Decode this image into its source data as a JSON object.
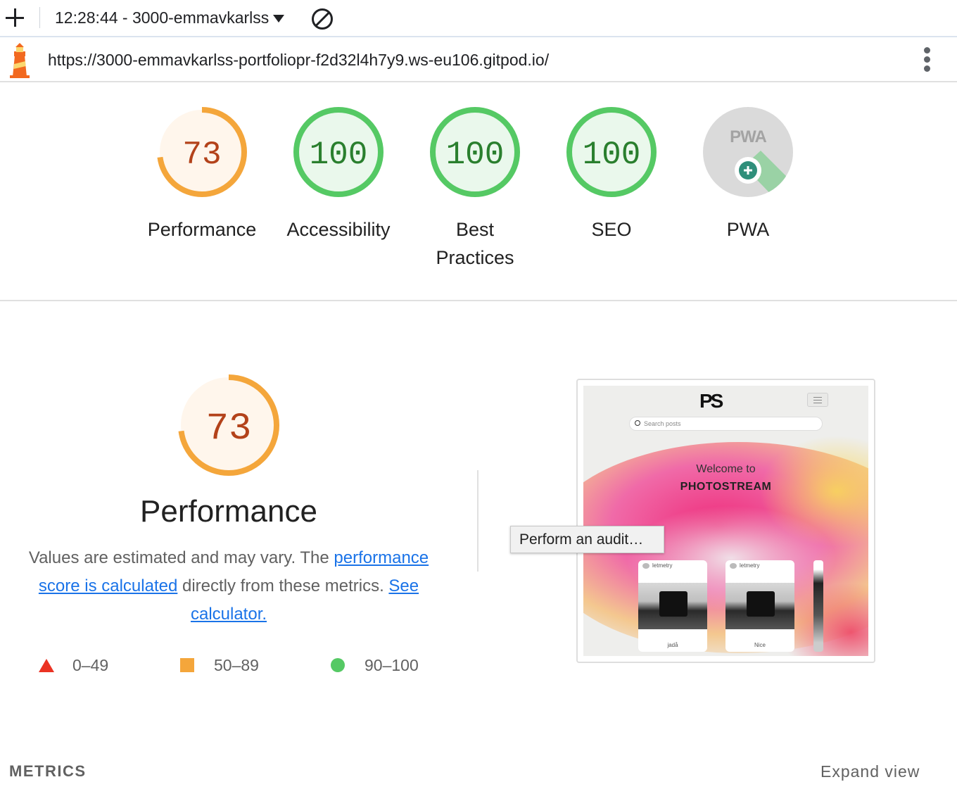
{
  "toolbar": {
    "report_label": "12:28:44 - 3000-emmavkarlss",
    "icons": {
      "new": "plus-icon",
      "dropdown": "caret-down-icon",
      "clear": "block-icon"
    }
  },
  "urlbar": {
    "url": "https://3000-emmavkarlss-portfoliopr-f2d32l4h7y9.ws-eu106.gitpod.io/",
    "icons": {
      "logo": "lighthouse-logo-icon",
      "menu": "kebab-menu-icon"
    }
  },
  "categories": [
    {
      "label": "Performance",
      "score": "73",
      "percent": 73,
      "rating": "average"
    },
    {
      "label": "Accessibility",
      "score": "100",
      "percent": 100,
      "rating": "pass"
    },
    {
      "label": "Best Practices",
      "score": "100",
      "percent": 100,
      "rating": "pass"
    },
    {
      "label": "SEO",
      "score": "100",
      "percent": 100,
      "rating": "pass"
    },
    {
      "label": "PWA",
      "badge": "PWA",
      "rating": "na"
    }
  ],
  "performance": {
    "score": "73",
    "percent": 73,
    "title": "Performance",
    "desc_prefix": "Values are estimated and may vary. The ",
    "desc_link1": "performance score is calculated",
    "desc_middle": " directly from these metrics. ",
    "desc_link2": "See calculator."
  },
  "legend": {
    "fail": "0–49",
    "average": "50–89",
    "pass": "90–100"
  },
  "screenshot": {
    "logo": "PS",
    "search_placeholder": "Search posts",
    "welcome": "Welcome to",
    "brand": "PHOTOSTREAM",
    "cards": [
      {
        "user": "letmetry",
        "caption": "jadå"
      },
      {
        "user": "letmetry",
        "caption": "Nice"
      }
    ]
  },
  "tooltip": "Perform an audit…",
  "footer": {
    "metrics_label": "METRICS",
    "expand_label": "Expand view"
  },
  "colors": {
    "average": "#f4a63b",
    "average_text": "#b3421a",
    "average_fill": "#fff6ec",
    "pass": "#55c964",
    "pass_text": "#2a7f2e",
    "pass_fill": "#eaf8ec",
    "fail": "#eb3323",
    "link": "#1a73e8"
  }
}
